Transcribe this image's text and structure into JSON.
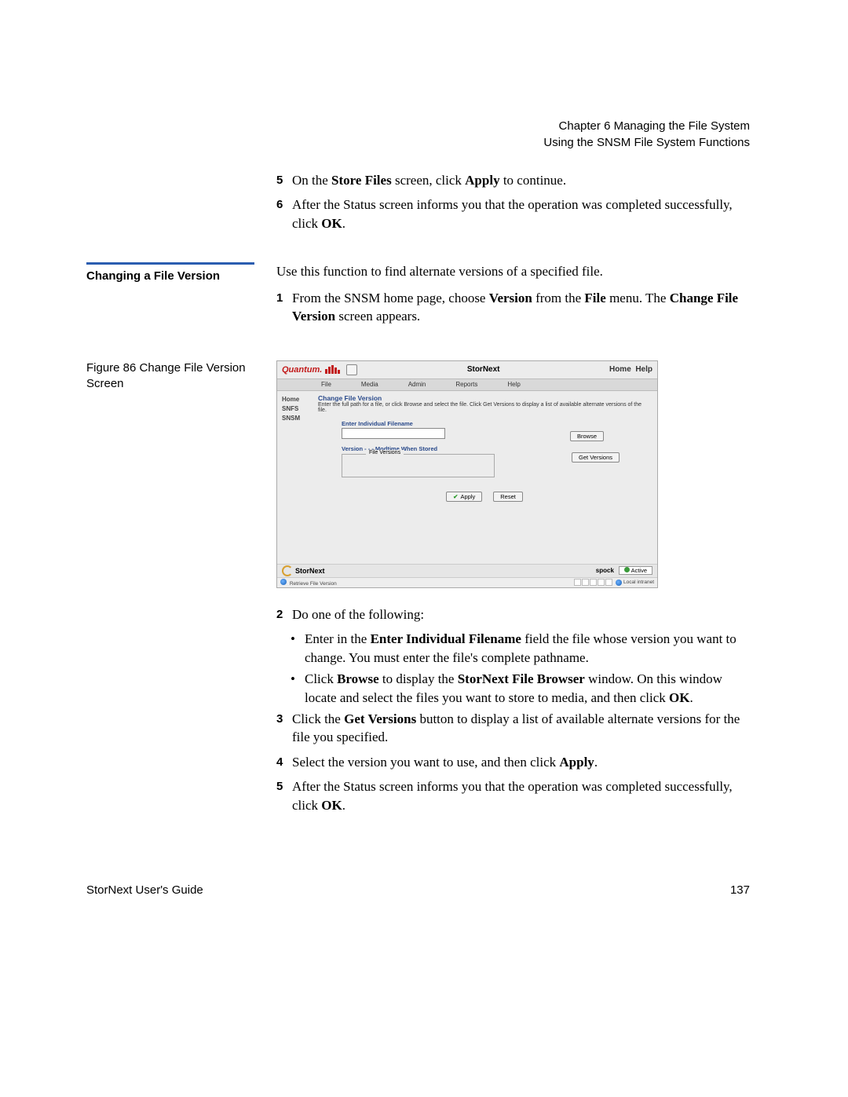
{
  "header": {
    "line1": "Chapter 6  Managing the File System",
    "line2": "Using the SNSM File System Functions"
  },
  "top_steps": {
    "s5_num": "5",
    "s5_a": "On the ",
    "s5_b": "Store Files",
    "s5_c": " screen, click ",
    "s5_d": "Apply",
    "s5_e": " to continue.",
    "s6_num": "6",
    "s6_a": "After the Status screen informs you that the operation was completed successfully, click ",
    "s6_b": "OK",
    "s6_c": "."
  },
  "sidebar": {
    "heading": "Changing a File Version",
    "fig_caption_a": "Figure 86  Change File Version",
    "fig_caption_b": "Screen"
  },
  "intro": {
    "p": "Use this function to find alternate versions of a specified file.",
    "s1_num": "1",
    "s1_a": "From the SNSM home page, choose ",
    "s1_b": "Version",
    "s1_c": " from the ",
    "s1_d": "File",
    "s1_e": " menu. The ",
    "s1_f": "Change File Version",
    "s1_g": " screen appears."
  },
  "shot": {
    "brand": "Quantum.",
    "title": "StorNext",
    "home": "Home",
    "help": "Help",
    "menu": {
      "file": "File",
      "media": "Media",
      "admin": "Admin",
      "reports": "Reports",
      "helpm": "Help"
    },
    "side": {
      "home": "Home",
      "snfs": "SNFS",
      "snsm": "SNSM"
    },
    "panel": {
      "title": "Change File Version",
      "desc": "Enter the full path for a file, or click Browse and select the file. Click Get Versions to display a list of available alternate versions of the file.",
      "indiv": "Enter Individual Filename",
      "browse": "Browse",
      "ver_label": "Version - - - Modtime When Stored",
      "legend": "File Versions",
      "getver": "Get Versions",
      "apply": "Apply",
      "reset": "Reset"
    },
    "footer1": {
      "sn": "StorNext",
      "host": "spock",
      "active": "Active"
    },
    "footer2": {
      "left": "Retrieve File Version",
      "right": "Local intranet"
    }
  },
  "after_steps": {
    "s2_num": "2",
    "s2": "Do one of the following:",
    "b1_a": "Enter in the ",
    "b1_b": "Enter Individual Filename",
    "b1_c": " field the file whose version you want to change. You must enter the file's complete pathname.",
    "b2_a": "Click ",
    "b2_b": "Browse",
    "b2_c": " to display the ",
    "b2_d": "StorNext File Browser",
    "b2_e": " window. On this window locate and select the files you want to store to media, and then click ",
    "b2_f": "OK",
    "b2_g": ".",
    "s3_num": "3",
    "s3_a": "Click the ",
    "s3_b": "Get Versions",
    "s3_c": " button to display a list of available alternate versions for the file you specified.",
    "s4_num": "4",
    "s4_a": "Select the version you want to use, and then click ",
    "s4_b": "Apply",
    "s4_c": ".",
    "s5_num": "5",
    "s5_a": "After the Status screen informs you that the operation was completed successfully, click ",
    "s5_b": "OK",
    "s5_c": "."
  },
  "footer": {
    "left": "StorNext User's Guide",
    "right": "137"
  }
}
